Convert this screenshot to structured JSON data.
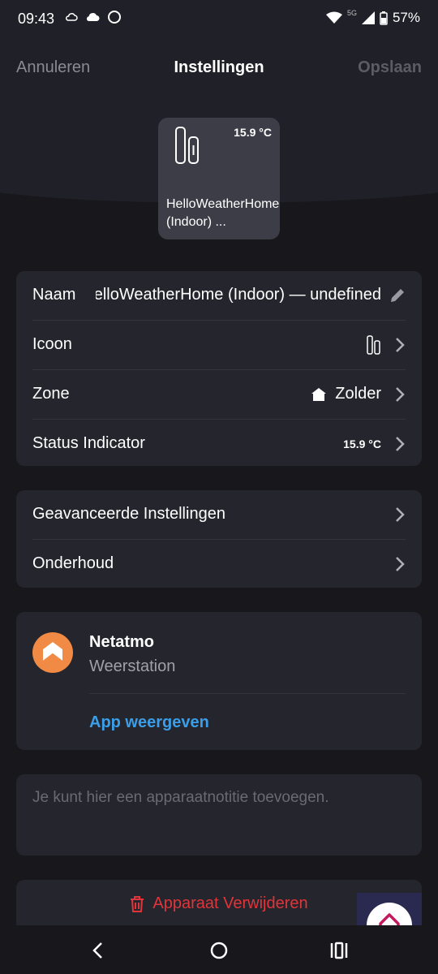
{
  "status_bar": {
    "time": "09:43",
    "network": "5G",
    "battery": "57%"
  },
  "header": {
    "cancel_label": "Annuleren",
    "title": "Instellingen",
    "save_label": "Opslaan"
  },
  "device_tile": {
    "temperature": "15.9 °C",
    "name": "HelloWeatherHome (Indoor) ..."
  },
  "settings": {
    "name_label": "Naam",
    "name_value": "HelloWeatherHome (Indoor) — undefined",
    "icon_label": "Icoon",
    "zone_label": "Zone",
    "zone_value": "Zolder",
    "status_label": "Status Indicator",
    "status_value": "15.9 °C"
  },
  "advanced": {
    "advanced_label": "Geavanceerde Instellingen",
    "maintenance_label": "Onderhoud"
  },
  "app": {
    "name": "Netatmo",
    "subtitle": "Weerstation",
    "link_label": "App weergeven",
    "color": "#f08a44"
  },
  "note": {
    "placeholder": "Je kunt hier een apparaatnotitie toevoegen."
  },
  "danger": {
    "delete_label": "Apparaat Verwijderen",
    "color": "#e0353a"
  },
  "icons": [
    "cloud-icon",
    "wifi-icon",
    "signal-icon",
    "battery-icon",
    "pencil-icon",
    "chevron-right-icon",
    "home-icon",
    "trash-icon",
    "back-icon",
    "recents-icon"
  ]
}
